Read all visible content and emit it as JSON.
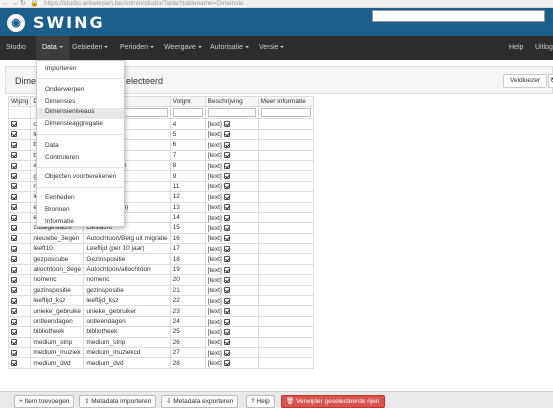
{
  "browser": {
    "url": "https://studio.antwerpen.be/Admin/studio/Table?tablename=Dimensie"
  },
  "brand": {
    "name": "SWING"
  },
  "nav": {
    "studio": "Studio",
    "items": [
      "Data",
      "Gebieden",
      "Perioden",
      "Weergave",
      "Autorisatie",
      "Versie"
    ],
    "help": "Help",
    "logout": "Uitlog"
  },
  "menu": {
    "items": [
      "Importeren",
      "Onderwerpen",
      "Dimensies",
      "Dimensieniveaus",
      "Dimensieaggregatie",
      "Data",
      "Controleren",
      "Objecten voorberekenen",
      "Eenheden",
      "Bronnen",
      "Informatie"
    ],
    "highlighted": "Dimensieniveaus"
  },
  "page": {
    "title_start": "Dimen",
    "title_end": "electeerd",
    "veldkiezer": "Veldkiezer"
  },
  "table": {
    "headers": [
      "Wijzig",
      "D",
      "",
      "Volgnr",
      "Beschrijving",
      "Meer informatie"
    ],
    "text_label": "[text]",
    "rows": [
      {
        "code": "o",
        "label": "gen",
        "volgnr": "4"
      },
      {
        "code": "le",
        "label": "sen)",
        "volgnr": "5"
      },
      {
        "code": "b",
        "label": "rs",
        "volgnr": "6"
      },
      {
        "code": "b",
        "label": "gsdagen",
        "volgnr": "7"
      },
      {
        "code": "a",
        "label": "e bibliotheken",
        "volgnr": "8"
      },
      {
        "code": "g",
        "label": "",
        "volgnr": "9"
      },
      {
        "code": "n",
        "label": "oep",
        "volgnr": "11"
      },
      {
        "code": "le",
        "label": "rie",
        "volgnr": "12"
      },
      {
        "code": "et",
        "label": "n (herkomst o)",
        "volgnr": "13"
      },
      {
        "code": "etgr2007",
        "label": "etgr2007",
        "volgnr": "14"
      },
      {
        "code": "codegeslacht",
        "label": "Geslacht",
        "volgnr": "15"
      },
      {
        "code": "nieuwbe_3egen",
        "label": "Autochtoon/Belg uit migratie",
        "volgnr": "16"
      },
      {
        "code": "leeft10",
        "label": "Leeftijd (per 10 jaar)",
        "volgnr": "17"
      },
      {
        "code": "gezposcube",
        "label": "Gezinspositie",
        "volgnr": "18"
      },
      {
        "code": "allochtoon_3ege",
        "label": "Autochtoon/allochtoon",
        "volgnr": "19"
      },
      {
        "code": "nomenc",
        "label": "nomenc",
        "volgnr": "20"
      },
      {
        "code": "gezinspositie",
        "label": "gezinspositie",
        "volgnr": "21"
      },
      {
        "code": "leeftijd_ksz",
        "label": "leeftijd_ksz",
        "volgnr": "22"
      },
      {
        "code": "unieke_gebruike",
        "label": "unieke_gebruiker",
        "volgnr": "23"
      },
      {
        "code": "ontleendagen",
        "label": "ontleendagen",
        "volgnr": "24"
      },
      {
        "code": "bibliotheek",
        "label": "bibliotheek",
        "volgnr": "25"
      },
      {
        "code": "medium_strip",
        "label": "medium_strip",
        "volgnr": "26"
      },
      {
        "code": "medium_muziek",
        "label": "medium_muziekcd",
        "volgnr": "27"
      },
      {
        "code": "medium_dvd",
        "label": "medium_dvd",
        "volgnr": "28"
      }
    ]
  },
  "footer": {
    "add": "Item toevoegen",
    "import": "Metadata importeren",
    "export": "Metadata exporteren",
    "help": "Help",
    "delete": "Verwijder geselecteerde rijen"
  }
}
